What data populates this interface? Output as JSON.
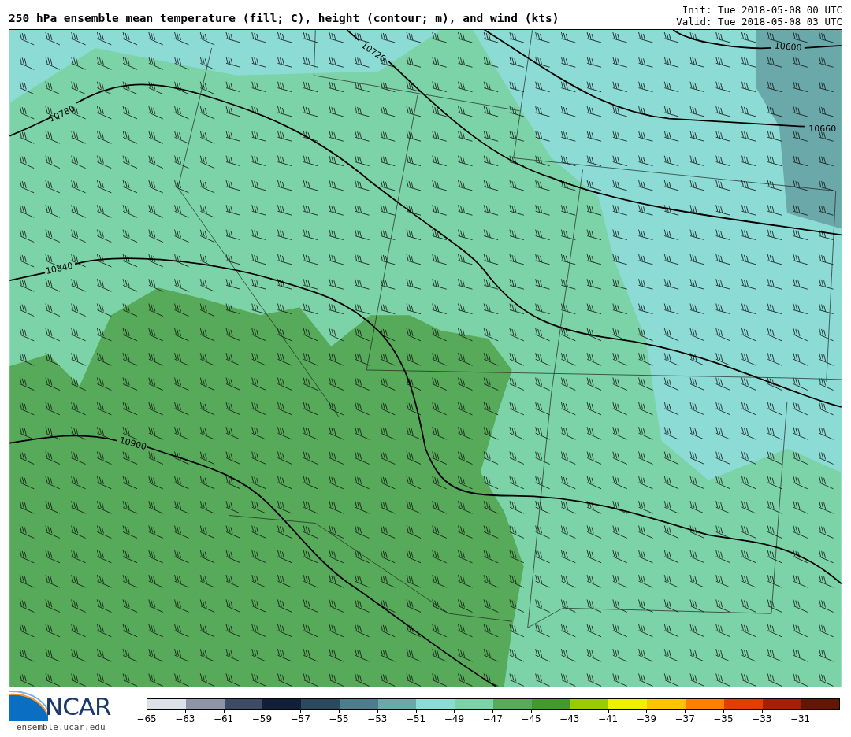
{
  "title": "250 hPa ensemble mean temperature (fill; C), height (contour; m), and wind (kts)",
  "init": "Init: Tue 2018-05-08 00 UTC",
  "valid": "Valid: Tue 2018-05-08 03 UTC",
  "map": {
    "contour_labels": [
      "10600",
      "10660",
      "10720",
      "10780",
      "10840",
      "10900"
    ]
  },
  "logo": {
    "text": "NCAR"
  },
  "website": "ensemble.ucar.edu",
  "colorbar": {
    "bins": [
      {
        "color": "#dde2e8"
      },
      {
        "color": "#8f95a8"
      },
      {
        "color": "#3f4a65"
      },
      {
        "color": "#121f3a"
      },
      {
        "color": "#2b4a60"
      },
      {
        "color": "#4e7c8c"
      },
      {
        "color": "#6aa8aa"
      },
      {
        "color": "#8cdbd5"
      },
      {
        "color": "#7dd3a8"
      },
      {
        "color": "#56aa5a"
      },
      {
        "color": "#429a2d"
      },
      {
        "color": "#99cc00"
      },
      {
        "color": "#eef200"
      },
      {
        "color": "#ffc400"
      },
      {
        "color": "#ff7f00"
      },
      {
        "color": "#e33d00"
      },
      {
        "color": "#a51e06"
      },
      {
        "color": "#621706"
      }
    ],
    "ticks": [
      "−65",
      "−63",
      "−61",
      "−59",
      "−57",
      "−55",
      "−53",
      "−51",
      "−49",
      "−47",
      "−45",
      "−43",
      "−41",
      "−39",
      "−37",
      "−35",
      "−33",
      "−31"
    ]
  }
}
